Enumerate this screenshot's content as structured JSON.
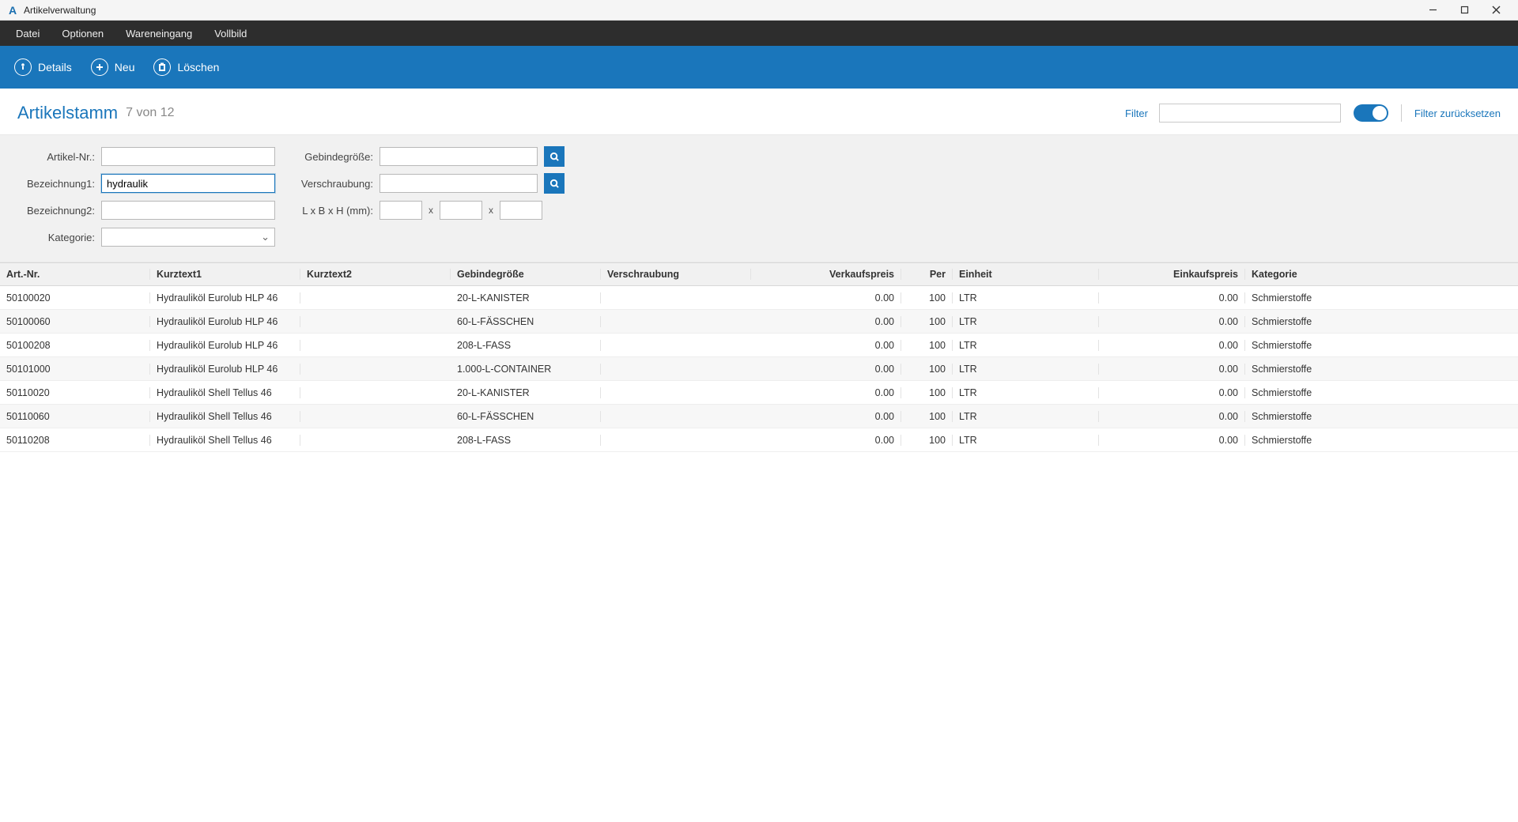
{
  "window": {
    "title": "Artikelverwaltung"
  },
  "menu": {
    "items": [
      "Datei",
      "Optionen",
      "Wareneingang",
      "Vollbild"
    ]
  },
  "toolbar": {
    "details": "Details",
    "neu": "Neu",
    "loeschen": "Löschen"
  },
  "header": {
    "title": "Artikelstamm",
    "count": "7 von 12",
    "filter_label": "Filter",
    "filter_value": "",
    "toggle_on": true,
    "reset": "Filter zurücksetzen"
  },
  "search": {
    "artnr_label": "Artikel-Nr.:",
    "artnr_value": "",
    "bez1_label": "Bezeichnung1:",
    "bez1_value": "hydraulik",
    "bez2_label": "Bezeichnung2:",
    "bez2_value": "",
    "kat_label": "Kategorie:",
    "kat_value": "",
    "gebinde_label": "Gebindegröße:",
    "gebinde_value": "",
    "versch_label": "Verschraubung:",
    "versch_value": "",
    "dim_label": "L x B x H (mm):",
    "dim_l": "",
    "dim_b": "",
    "dim_h": ""
  },
  "table": {
    "columns": [
      "Art.-Nr.",
      "Kurztext1",
      "Kurztext2",
      "Gebindegröße",
      "Verschraubung",
      "Verkaufspreis",
      "Per",
      "Einheit",
      "Einkaufspreis",
      "Kategorie"
    ],
    "rows": [
      {
        "artnr": "50100020",
        "kurz1": "Hydrauliköl Eurolub HLP 46",
        "kurz2": "",
        "gebinde": "20-L-KANISTER",
        "versch": "",
        "vk": "0.00",
        "per": "100",
        "einh": "LTR",
        "ek": "0.00",
        "kat": "Schmierstoffe"
      },
      {
        "artnr": "50100060",
        "kurz1": "Hydrauliköl Eurolub HLP 46",
        "kurz2": "",
        "gebinde": "60-L-FÄSSCHEN",
        "versch": "",
        "vk": "0.00",
        "per": "100",
        "einh": "LTR",
        "ek": "0.00",
        "kat": "Schmierstoffe"
      },
      {
        "artnr": "50100208",
        "kurz1": "Hydrauliköl Eurolub HLP 46",
        "kurz2": "",
        "gebinde": "208-L-FASS",
        "versch": "",
        "vk": "0.00",
        "per": "100",
        "einh": "LTR",
        "ek": "0.00",
        "kat": "Schmierstoffe"
      },
      {
        "artnr": "50101000",
        "kurz1": "Hydrauliköl Eurolub HLP 46",
        "kurz2": "",
        "gebinde": "1.000-L-CONTAINER",
        "versch": "",
        "vk": "0.00",
        "per": "100",
        "einh": "LTR",
        "ek": "0.00",
        "kat": "Schmierstoffe"
      },
      {
        "artnr": "50110020",
        "kurz1": "Hydrauliköl Shell Tellus 46",
        "kurz2": "",
        "gebinde": "20-L-KANISTER",
        "versch": "",
        "vk": "0.00",
        "per": "100",
        "einh": "LTR",
        "ek": "0.00",
        "kat": "Schmierstoffe"
      },
      {
        "artnr": "50110060",
        "kurz1": "Hydrauliköl Shell Tellus 46",
        "kurz2": "",
        "gebinde": "60-L-FÄSSCHEN",
        "versch": "",
        "vk": "0.00",
        "per": "100",
        "einh": "LTR",
        "ek": "0.00",
        "kat": "Schmierstoffe"
      },
      {
        "artnr": "50110208",
        "kurz1": "Hydrauliköl Shell Tellus 46",
        "kurz2": "",
        "gebinde": "208-L-FASS",
        "versch": "",
        "vk": "0.00",
        "per": "100",
        "einh": "LTR",
        "ek": "0.00",
        "kat": "Schmierstoffe"
      }
    ]
  }
}
